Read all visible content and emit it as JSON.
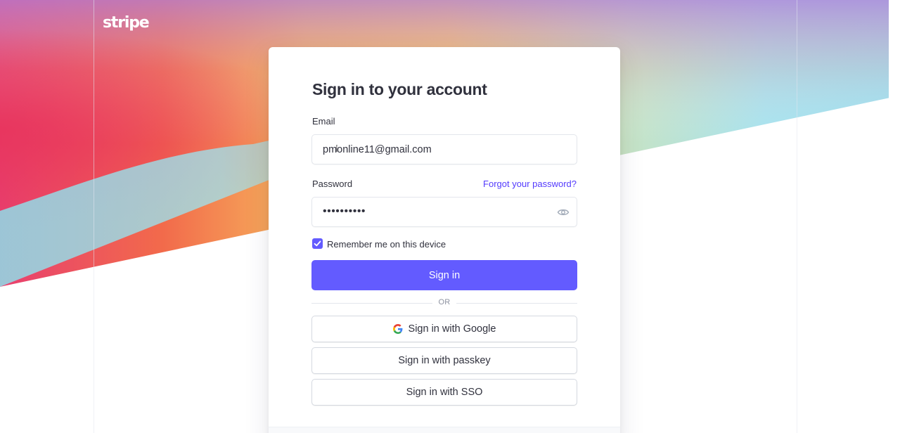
{
  "brand": {
    "logo_text": "stripe"
  },
  "card": {
    "title": "Sign in to your account",
    "email": {
      "label": "Email",
      "value": "pmonline11@gmail.com"
    },
    "password": {
      "label": "Password",
      "masked_value": "••••••••••",
      "forgot_link": "Forgot your password?",
      "toggle_icon": "eye-icon"
    },
    "remember": {
      "label": "Remember me on this device",
      "checked": true
    },
    "sign_in_button": "Sign in",
    "divider_text": "OR",
    "alt_signin": {
      "google": "Sign in with Google",
      "passkey": "Sign in with passkey",
      "sso": "Sign in with SSO"
    }
  },
  "colors": {
    "accent": "#635bff",
    "link": "#533afd",
    "text": "#30313d"
  }
}
